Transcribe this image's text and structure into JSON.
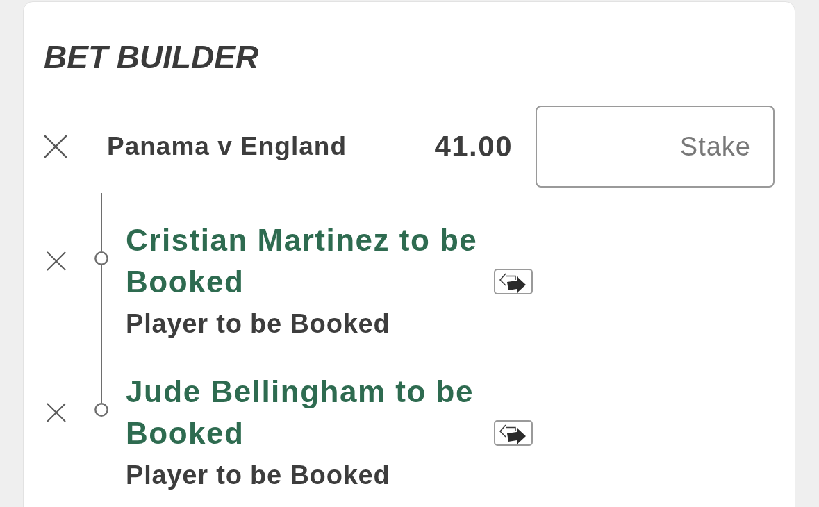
{
  "title": "BET BUILDER",
  "bet": {
    "event": "Panama v England",
    "odds": "41.00",
    "stake": {
      "placeholder": "Stake"
    }
  },
  "selections": [
    {
      "name": "Cristian Martinez to be Booked",
      "market": "Player to be Booked"
    },
    {
      "name": "Jude Bellingham to be Booked",
      "market": "Player to be Booked"
    }
  ]
}
